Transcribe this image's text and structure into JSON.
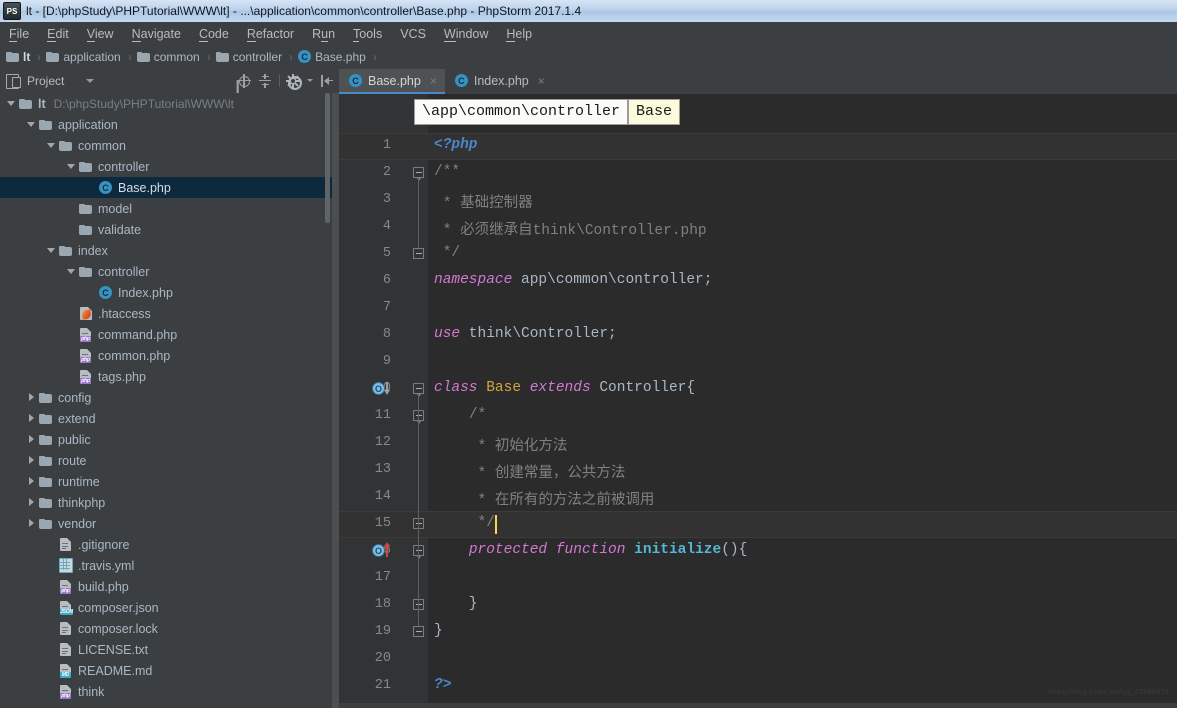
{
  "window": {
    "title": "lt - [D:\\phpStudy\\PHPTutorial\\WWW\\lt] - ...\\application\\common\\controller\\Base.php - PhpStorm 2017.1.4",
    "app_icon": "PS"
  },
  "menubar": {
    "items": [
      {
        "label": "File",
        "mnemonic": "F",
        "rest": "ile"
      },
      {
        "label": "Edit",
        "mnemonic": "E",
        "rest": "dit"
      },
      {
        "label": "View",
        "mnemonic": "V",
        "rest": "iew"
      },
      {
        "label": "Navigate",
        "mnemonic": "N",
        "rest": "avigate"
      },
      {
        "label": "Code",
        "mnemonic": "C",
        "rest": "ode"
      },
      {
        "label": "Refactor",
        "mnemonic": "R",
        "rest": "efactor"
      },
      {
        "label": "Run",
        "mnemonic": "Ru",
        "rest": "n"
      },
      {
        "label": "Tools",
        "mnemonic": "T",
        "rest": "ools"
      },
      {
        "label": "VCS",
        "mnemonic": "",
        "rest": "VCS"
      },
      {
        "label": "Window",
        "mnemonic": "W",
        "rest": "indow"
      },
      {
        "label": "Help",
        "mnemonic": "H",
        "rest": "elp"
      }
    ]
  },
  "breadcrumb": {
    "items": [
      {
        "label": "lt",
        "icon": "folder-icon"
      },
      {
        "label": "application",
        "icon": "folder-icon"
      },
      {
        "label": "common",
        "icon": "folder-icon"
      },
      {
        "label": "controller",
        "icon": "folder-icon"
      },
      {
        "label": "Base.php",
        "icon": "php-class-icon"
      }
    ],
    "separator": "›"
  },
  "project_panel": {
    "title": "Project",
    "tools": [
      "locate-icon",
      "collapse-all-icon",
      "settings-gear-icon",
      "hide-panel-icon"
    ],
    "tree": [
      {
        "label": "lt",
        "sub": "D:\\phpStudy\\PHPTutorial\\WWW\\lt",
        "depth": 0,
        "arrow": "down",
        "icon": "folder-icon",
        "bold": true
      },
      {
        "label": "application",
        "sub": "",
        "depth": 1,
        "arrow": "down",
        "icon": "folder-icon"
      },
      {
        "label": "common",
        "sub": "",
        "depth": 2,
        "arrow": "down",
        "icon": "folder-icon"
      },
      {
        "label": "controller",
        "sub": "",
        "depth": 3,
        "arrow": "down",
        "icon": "folder-icon"
      },
      {
        "label": "Base.php",
        "sub": "",
        "depth": 4,
        "arrow": "none",
        "icon": "php-class-icon",
        "selected": true
      },
      {
        "label": "model",
        "sub": "",
        "depth": 3,
        "arrow": "none",
        "icon": "folder-icon"
      },
      {
        "label": "validate",
        "sub": "",
        "depth": 3,
        "arrow": "none",
        "icon": "folder-icon"
      },
      {
        "label": "index",
        "sub": "",
        "depth": 2,
        "arrow": "down",
        "icon": "folder-icon"
      },
      {
        "label": "controller",
        "sub": "",
        "depth": 3,
        "arrow": "down",
        "icon": "folder-icon"
      },
      {
        "label": "Index.php",
        "sub": "",
        "depth": 4,
        "arrow": "none",
        "icon": "php-class-icon"
      },
      {
        "label": ".htaccess",
        "sub": "",
        "depth": 3,
        "arrow": "none",
        "icon": "htaccess-icon"
      },
      {
        "label": "command.php",
        "sub": "",
        "depth": 3,
        "arrow": "none",
        "icon": "php-file-icon"
      },
      {
        "label": "common.php",
        "sub": "",
        "depth": 3,
        "arrow": "none",
        "icon": "php-file-icon"
      },
      {
        "label": "tags.php",
        "sub": "",
        "depth": 3,
        "arrow": "none",
        "icon": "php-file-icon"
      },
      {
        "label": "config",
        "sub": "",
        "depth": 1,
        "arrow": "right",
        "icon": "folder-icon"
      },
      {
        "label": "extend",
        "sub": "",
        "depth": 1,
        "arrow": "right",
        "icon": "folder-icon"
      },
      {
        "label": "public",
        "sub": "",
        "depth": 1,
        "arrow": "right",
        "icon": "folder-icon"
      },
      {
        "label": "route",
        "sub": "",
        "depth": 1,
        "arrow": "right",
        "icon": "folder-icon"
      },
      {
        "label": "runtime",
        "sub": "",
        "depth": 1,
        "arrow": "right",
        "icon": "folder-icon"
      },
      {
        "label": "thinkphp",
        "sub": "",
        "depth": 1,
        "arrow": "right",
        "icon": "folder-icon"
      },
      {
        "label": "vendor",
        "sub": "",
        "depth": 1,
        "arrow": "right",
        "icon": "folder-icon"
      },
      {
        "label": ".gitignore",
        "sub": "",
        "depth": 2,
        "arrow": "none",
        "icon": "text-file-icon"
      },
      {
        "label": ".travis.yml",
        "sub": "",
        "depth": 2,
        "arrow": "none",
        "icon": "yml-file-icon"
      },
      {
        "label": "build.php",
        "sub": "",
        "depth": 2,
        "arrow": "none",
        "icon": "php-file-icon"
      },
      {
        "label": "composer.json",
        "sub": "",
        "depth": 2,
        "arrow": "none",
        "icon": "json-file-icon"
      },
      {
        "label": "composer.lock",
        "sub": "",
        "depth": 2,
        "arrow": "none",
        "icon": "text-file-icon"
      },
      {
        "label": "LICENSE.txt",
        "sub": "",
        "depth": 2,
        "arrow": "none",
        "icon": "text-file-icon"
      },
      {
        "label": "README.md",
        "sub": "",
        "depth": 2,
        "arrow": "none",
        "icon": "md-file-icon"
      },
      {
        "label": "think",
        "sub": "",
        "depth": 2,
        "arrow": "none",
        "icon": "php-file-icon"
      }
    ]
  },
  "editor": {
    "tabs": [
      {
        "label": "Base.php",
        "icon": "php-class-icon",
        "active": true,
        "close": "×"
      },
      {
        "label": "Index.php",
        "icon": "php-class-icon",
        "active": false,
        "close": "×"
      }
    ],
    "nav_popup": {
      "namespace": "\\app\\common\\controller",
      "class": "Base"
    },
    "lines": [
      {
        "num": "1",
        "text": "<?php",
        "highlight": true
      },
      {
        "num": "2",
        "text": "/**"
      },
      {
        "num": "3",
        "text": " * 基础控制器"
      },
      {
        "num": "4",
        "text": " * 必须继承自think\\Controller.php"
      },
      {
        "num": "5",
        "text": " */"
      },
      {
        "num": "6",
        "text": "namespace app\\common\\controller;"
      },
      {
        "num": "7",
        "text": ""
      },
      {
        "num": "8",
        "text": "use think\\Controller;"
      },
      {
        "num": "9",
        "text": ""
      },
      {
        "num": "10",
        "text": "class Base extends Controller{",
        "marker": "overridden-down"
      },
      {
        "num": "11",
        "text": "    /*"
      },
      {
        "num": "12",
        "text": "     * 初始化方法"
      },
      {
        "num": "13",
        "text": "     * 创建常量，公共方法"
      },
      {
        "num": "14",
        "text": "     * 在所有的方法之前被调用"
      },
      {
        "num": "15",
        "text": "     */",
        "caret": true,
        "highlight": true
      },
      {
        "num": "16",
        "text": "    protected function initialize(){",
        "marker": "overriding-up"
      },
      {
        "num": "17",
        "text": ""
      },
      {
        "num": "18",
        "text": "    }"
      },
      {
        "num": "19",
        "text": "}"
      },
      {
        "num": "20",
        "text": ""
      },
      {
        "num": "21",
        "text": "?>"
      }
    ]
  },
  "watermark": {
    "text": "https://blog.csdn.net/qq_42986973"
  },
  "colors": {
    "accent": "#4a88c7",
    "selection": "#0d293e",
    "editor_bg": "#2b2b2b",
    "panel_bg": "#3c3f41",
    "gutter_bg": "#313335",
    "keyword": "#d278d2",
    "class_name": "#cfa63b",
    "comment": "#808080",
    "function": "#56b6d4",
    "tag": "#4a86c8",
    "caret": "#ffd24a"
  }
}
